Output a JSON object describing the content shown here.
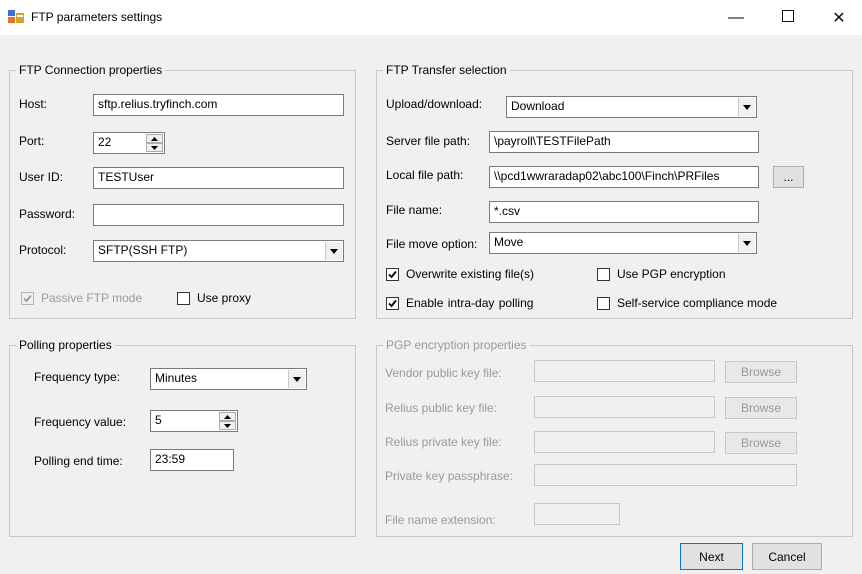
{
  "window": {
    "title": "FTP parameters settings",
    "minimize_glyph": "—",
    "maximize_glyph": "☐",
    "close_glyph": "✕"
  },
  "connection": {
    "group_title": "FTP Connection properties",
    "host_label": "Host:",
    "host_value": "sftp.relius.tryfinch.com",
    "port_label": "Port:",
    "port_value": "22",
    "userid_label": "User ID:",
    "userid_value": "TESTUser",
    "password_label": "Password:",
    "password_value": "",
    "protocol_label": "Protocol:",
    "protocol_value": "SFTP(SSH FTP)",
    "passive_label": "Passive FTP mode",
    "passive_checked": true,
    "proxy_label": "Use proxy",
    "proxy_checked": false
  },
  "transfer": {
    "group_title": "FTP Transfer selection",
    "updown_label": "Upload/download:",
    "updown_value": "Download",
    "server_path_label": "Server file path:",
    "server_path_value": "\\payroll\\TESTFilePath",
    "local_path_label": "Local file path:",
    "local_path_value": "\\\\pcd1wwraradap02\\abc100\\Finch\\PRFiles",
    "browse_label": "...",
    "filename_label": "File name:",
    "filename_value": "*.csv",
    "move_label": "File move option:",
    "move_value": "Move",
    "overwrite_label": "Overwrite existing file(s)",
    "overwrite_checked": true,
    "intraday_label": "Enable  intra-day  polling",
    "intraday_checked": true,
    "pgp_label": "Use PGP encryption",
    "pgp_checked": false,
    "selfservice_label": "Self-service compliance mode",
    "selfservice_checked": false
  },
  "polling": {
    "group_title": "Polling properties",
    "freq_type_label": "Frequency type:",
    "freq_type_value": "Minutes",
    "freq_value_label": "Frequency value:",
    "freq_value": "5",
    "end_time_label": "Polling end time:",
    "end_time_value": "23:59"
  },
  "pgp": {
    "group_title": "PGP encryption properties",
    "vendor_label": "Vendor public key file:",
    "relius_public_label": "Relius public key file:",
    "relius_private_label": "Relius private key file:",
    "passphrase_label": "Private key passphrase:",
    "extension_label": "File name extension:",
    "browse_label": "Browse"
  },
  "footer": {
    "next_label": "Next",
    "cancel_label": "Cancel"
  }
}
